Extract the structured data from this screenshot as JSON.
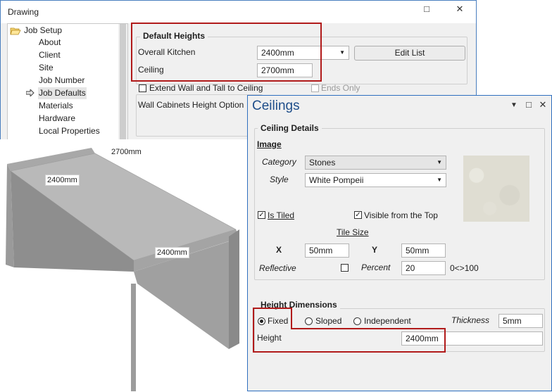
{
  "drawing_window": {
    "title": "Drawing",
    "minimize_glyph": "□",
    "close_glyph": "✕",
    "tree": {
      "root": "Job Setup",
      "items": [
        "About",
        "Client",
        "Site",
        "Job Number",
        "Job Defaults",
        "Materials",
        "Hardware",
        "Local Properties"
      ],
      "selected": "Job Defaults"
    },
    "default_heights": {
      "legend": "Default Heights",
      "overall_kitchen_label": "Overall Kitchen",
      "overall_kitchen_value": "2400mm",
      "ceiling_label": "Ceiling",
      "ceiling_value": "2700mm",
      "edit_list_label": "Edit List"
    },
    "extend_wall_label": "Extend Wall and Tall to Ceiling",
    "ends_only_label": "Ends Only",
    "wall_cab_height_label": "Wall Cabinets Height Option"
  },
  "view3d": {
    "dim_ceiling": "2700mm",
    "dim_top": "2400mm",
    "dim_front": "2400mm"
  },
  "ceilings_window": {
    "title": "Ceilings",
    "pin_glyph": "▼",
    "max_glyph": "□",
    "close_glyph": "✕",
    "details": {
      "legend": "Ceiling Details",
      "image_heading": "Image",
      "category_label": "Category",
      "category_value": "Stones",
      "style_label": "Style",
      "style_value": "White Pompeii",
      "is_tiled_label": "Is Tiled",
      "visible_top_label": "Visible from the Top",
      "tile_size_label": "Tile Size",
      "x_label": "X",
      "x_value": "50mm",
      "y_label": "Y",
      "y_value": "50mm",
      "reflective_label": "Reflective",
      "percent_label": "Percent",
      "percent_value": "20",
      "percent_range": "0<>100"
    },
    "height": {
      "legend": "Height Dimensions",
      "fixed_label": "Fixed",
      "sloped_label": "Sloped",
      "independent_label": "Independent",
      "thickness_label": "Thickness",
      "thickness_value": "5mm",
      "height_label": "Height",
      "height_value": "2400mm"
    }
  }
}
